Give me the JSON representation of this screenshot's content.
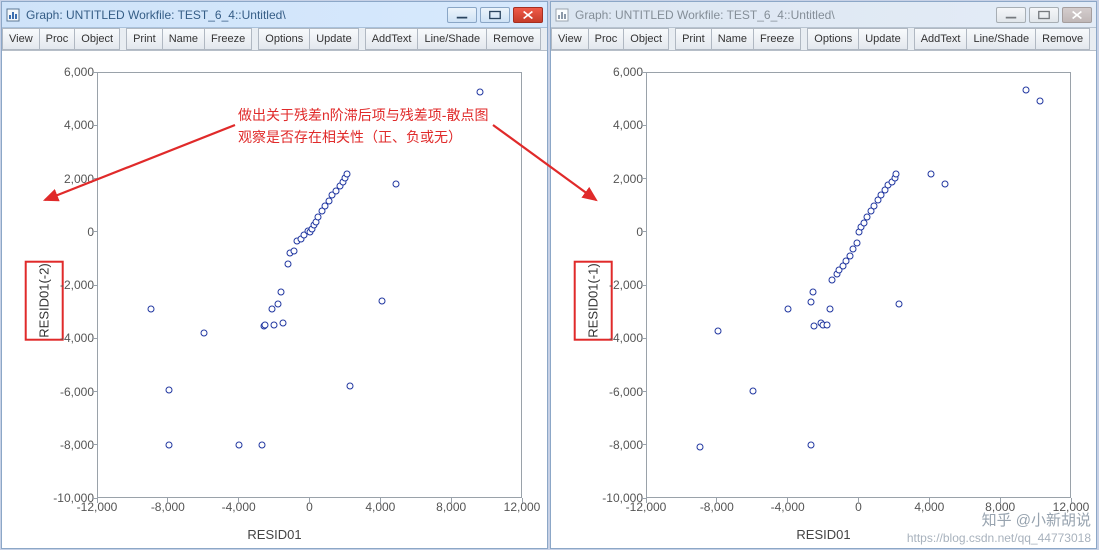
{
  "titles": {
    "left": "Graph: UNTITLED   Workfile: TEST_6_4::Untitled\\",
    "right": "Graph: UNTITLED   Workfile: TEST_6_4::Untitled\\"
  },
  "toolbar": {
    "view": "View",
    "proc": "Proc",
    "object": "Object",
    "print": "Print",
    "name": "Name",
    "freeze": "Freeze",
    "options": "Options",
    "update": "Update",
    "addtext": "AddText",
    "lineshade": "Line/Shade",
    "remove": "Remove"
  },
  "annotation": {
    "line1": "做出关于残差n阶滞后项与残差项-散点图",
    "line2": "观察是否存在相关性（正、负或无）"
  },
  "watermark": {
    "big": "知乎 @小新胡说",
    "small": "https://blog.csdn.net/qq_44773018"
  },
  "axis": {
    "xlabel": "RESID01",
    "ylabel_left": "RESID01(-2)",
    "ylabel_right": "RESID01(-1)",
    "xrange": [
      -12000,
      12000
    ],
    "yrange": [
      -10000,
      6000
    ],
    "xticks": [
      {
        "v": -12000,
        "l": "-12,000"
      },
      {
        "v": -8000,
        "l": "-8,000"
      },
      {
        "v": -4000,
        "l": "-4,000"
      },
      {
        "v": 0,
        "l": "0"
      },
      {
        "v": 4000,
        "l": "4,000"
      },
      {
        "v": 8000,
        "l": "8,000"
      },
      {
        "v": 12000,
        "l": "12,000"
      }
    ],
    "yticks": [
      {
        "v": 6000,
        "l": "6,000"
      },
      {
        "v": 4000,
        "l": "4,000"
      },
      {
        "v": 2000,
        "l": "2,000"
      },
      {
        "v": 0,
        "l": "0"
      },
      {
        "v": -2000,
        "l": "-2,000"
      },
      {
        "v": -4000,
        "l": "-4,000"
      },
      {
        "v": -6000,
        "l": "-6,000"
      },
      {
        "v": -8000,
        "l": "-8,000"
      },
      {
        "v": -10000,
        "l": "-10,000"
      }
    ]
  },
  "chart_data": [
    {
      "type": "scatter",
      "title": "",
      "window": "left",
      "xlabel": "RESID01",
      "ylabel": "RESID01(-2)",
      "xlim": [
        -12000,
        12000
      ],
      "ylim": [
        -10000,
        6000
      ],
      "series": [
        {
          "name": "",
          "points": [
            [
              -9000,
              -2900
            ],
            [
              -8000,
              -8050
            ],
            [
              -8000,
              -5950
            ],
            [
              -6000,
              -3800
            ],
            [
              -4000,
              -8050
            ],
            [
              -2700,
              -8050
            ],
            [
              -2600,
              -3550
            ],
            [
              -2500,
              -3500
            ],
            [
              -2100,
              -2900
            ],
            [
              -2000,
              -3500
            ],
            [
              -1800,
              -2700
            ],
            [
              -1600,
              -2250
            ],
            [
              -1500,
              -3450
            ],
            [
              -1200,
              -1200
            ],
            [
              -1100,
              -800
            ],
            [
              -900,
              -700
            ],
            [
              -700,
              -350
            ],
            [
              -500,
              -250
            ],
            [
              -300,
              -100
            ],
            [
              -100,
              50
            ],
            [
              0,
              0
            ],
            [
              150,
              120
            ],
            [
              250,
              250
            ],
            [
              350,
              380
            ],
            [
              500,
              550
            ],
            [
              700,
              780
            ],
            [
              900,
              1000
            ],
            [
              1100,
              1180
            ],
            [
              1300,
              1400
            ],
            [
              1500,
              1550
            ],
            [
              1750,
              1750
            ],
            [
              1900,
              1900
            ],
            [
              2000,
              2050
            ],
            [
              2100,
              2200
            ],
            [
              2300,
              -5800
            ],
            [
              4100,
              -2600
            ],
            [
              4900,
              1800
            ],
            [
              9700,
              5300
            ]
          ]
        }
      ]
    },
    {
      "type": "scatter",
      "title": "",
      "window": "right",
      "xlabel": "RESID01",
      "ylabel": "RESID01(-1)",
      "xlim": [
        -12000,
        12000
      ],
      "ylim": [
        -10000,
        6000
      ],
      "series": [
        {
          "name": "",
          "points": [
            [
              -9000,
              -8100
            ],
            [
              -8000,
              -3750
            ],
            [
              -6000,
              -6000
            ],
            [
              -4000,
              -2900
            ],
            [
              -2700,
              -8050
            ],
            [
              -2700,
              -2650
            ],
            [
              -2600,
              -2250
            ],
            [
              -2500,
              -3550
            ],
            [
              -2100,
              -3450
            ],
            [
              -2000,
              -3500
            ],
            [
              -1800,
              -3500
            ],
            [
              -1600,
              -2900
            ],
            [
              -1500,
              -1800
            ],
            [
              -1200,
              -1600
            ],
            [
              -1100,
              -1450
            ],
            [
              -900,
              -1300
            ],
            [
              -700,
              -1100
            ],
            [
              -500,
              -900
            ],
            [
              -300,
              -650
            ],
            [
              -100,
              -400
            ],
            [
              0,
              0
            ],
            [
              150,
              180
            ],
            [
              300,
              350
            ],
            [
              500,
              550
            ],
            [
              700,
              780
            ],
            [
              900,
              1000
            ],
            [
              1100,
              1200
            ],
            [
              1300,
              1400
            ],
            [
              1500,
              1600
            ],
            [
              1700,
              1780
            ],
            [
              1900,
              1900
            ],
            [
              2050,
              2050
            ],
            [
              2150,
              2200
            ],
            [
              2300,
              -2700
            ],
            [
              4100,
              2200
            ],
            [
              4900,
              1800
            ],
            [
              9500,
              5350
            ],
            [
              10300,
              4950
            ]
          ]
        }
      ]
    }
  ]
}
